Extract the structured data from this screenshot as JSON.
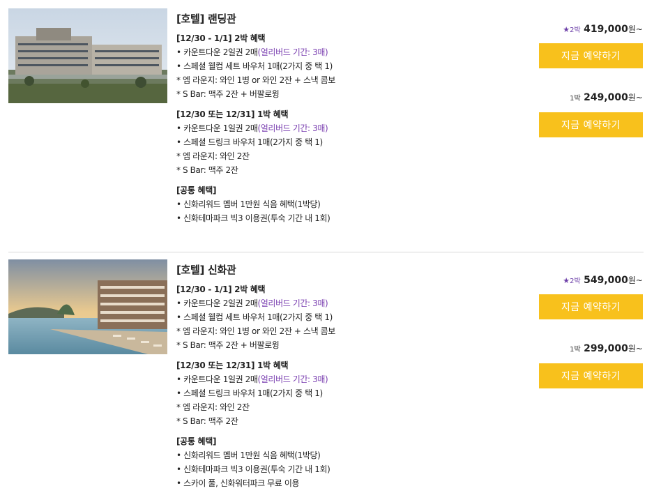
{
  "cards": [
    {
      "title": "[호텔] 랜딩관",
      "sections": [
        {
          "heading": "[12/30 - 1/1] 2박 혜택",
          "lines": [
            {
              "text": "• 카운트다운 2일권 2매",
              "hl": "(얼리버드 기간: 3매)"
            },
            {
              "text": "• 스페셜 웰컴 세트 바우처 1매(2가지 중 택 1)",
              "hl": ""
            },
            {
              "text": "* 엠 라운지: 와인 1병 or 와인 2잔 + 스낵 콤보",
              "hl": ""
            },
            {
              "text": "* S Bar: 맥주 2잔 + 버팔로윙",
              "hl": ""
            }
          ]
        },
        {
          "heading": "[12/30 또는 12/31] 1박 혜택",
          "lines": [
            {
              "text": "• 카운트다운 1일권 2매",
              "hl": "(얼리버드 기간: 3매)"
            },
            {
              "text": "• 스페셜 드링크 바우처 1매(2가지 중 택 1)",
              "hl": ""
            },
            {
              "text": "* 엠 라운지: 와인 2잔",
              "hl": ""
            },
            {
              "text": "* S Bar: 맥주 2잔",
              "hl": ""
            }
          ]
        },
        {
          "heading": "[공통 혜택]",
          "lines": [
            {
              "text": "• 신화리워드 멤버 1만원 식음 혜택(1박당)",
              "hl": ""
            },
            {
              "text": "• 신화테마파크 빅3 이용권(투숙 기간 내 1회)",
              "hl": ""
            }
          ]
        }
      ],
      "offers": [
        {
          "star": "★",
          "nights": "2박",
          "amount": "419,000",
          "unit": "원~",
          "button": "지금 예약하기"
        },
        {
          "star": "",
          "nights": "1박",
          "amount": "249,000",
          "unit": "원~",
          "button": "지금 예약하기"
        }
      ]
    },
    {
      "title": "[호텔] 신화관",
      "sections": [
        {
          "heading": "[12/30 - 1/1] 2박 혜택",
          "lines": [
            {
              "text": "• 카운트다운 2일권 2매",
              "hl": "(얼리버드 기간: 3매)"
            },
            {
              "text": "• 스페셜 웰컴 세트 바우처 1매(2가지 중 택 1)",
              "hl": ""
            },
            {
              "text": "* 엠 라운지: 와인 1병 or 와인 2잔 + 스낵 콤보",
              "hl": ""
            },
            {
              "text": "* S Bar: 맥주 2잔 + 버팔로윙",
              "hl": ""
            }
          ]
        },
        {
          "heading": "[12/30 또는 12/31] 1박 혜택",
          "lines": [
            {
              "text": "• 카운트다운 1일권 2매",
              "hl": "(얼리버드 기간: 3매)"
            },
            {
              "text": "• 스페셜 드링크 바우처 1매(2가지 중 택 1)",
              "hl": ""
            },
            {
              "text": "* 엠 라운지: 와인 2잔",
              "hl": ""
            },
            {
              "text": "* S Bar: 맥주 2잔",
              "hl": ""
            }
          ]
        },
        {
          "heading": "[공통 혜택]",
          "lines": [
            {
              "text": "• 신화리워드 멤버 1만원 식음 혜택(1박당)",
              "hl": ""
            },
            {
              "text": "• 신화테마파크 빅3 이용권(투숙 기간 내 1회)",
              "hl": ""
            },
            {
              "text": "• 스카이 풀, 신화워터파크 무료 이용",
              "hl": ""
            }
          ]
        }
      ],
      "offers": [
        {
          "star": "★",
          "nights": "2박",
          "amount": "549,000",
          "unit": "원~",
          "button": "지금 예약하기"
        },
        {
          "star": "",
          "nights": "1박",
          "amount": "299,000",
          "unit": "원~",
          "button": "지금 예약하기"
        }
      ]
    }
  ],
  "colors": {
    "accent_button": "#f8c11c",
    "highlight_text": "#7a3fb0",
    "star": "#6c3fa8"
  }
}
